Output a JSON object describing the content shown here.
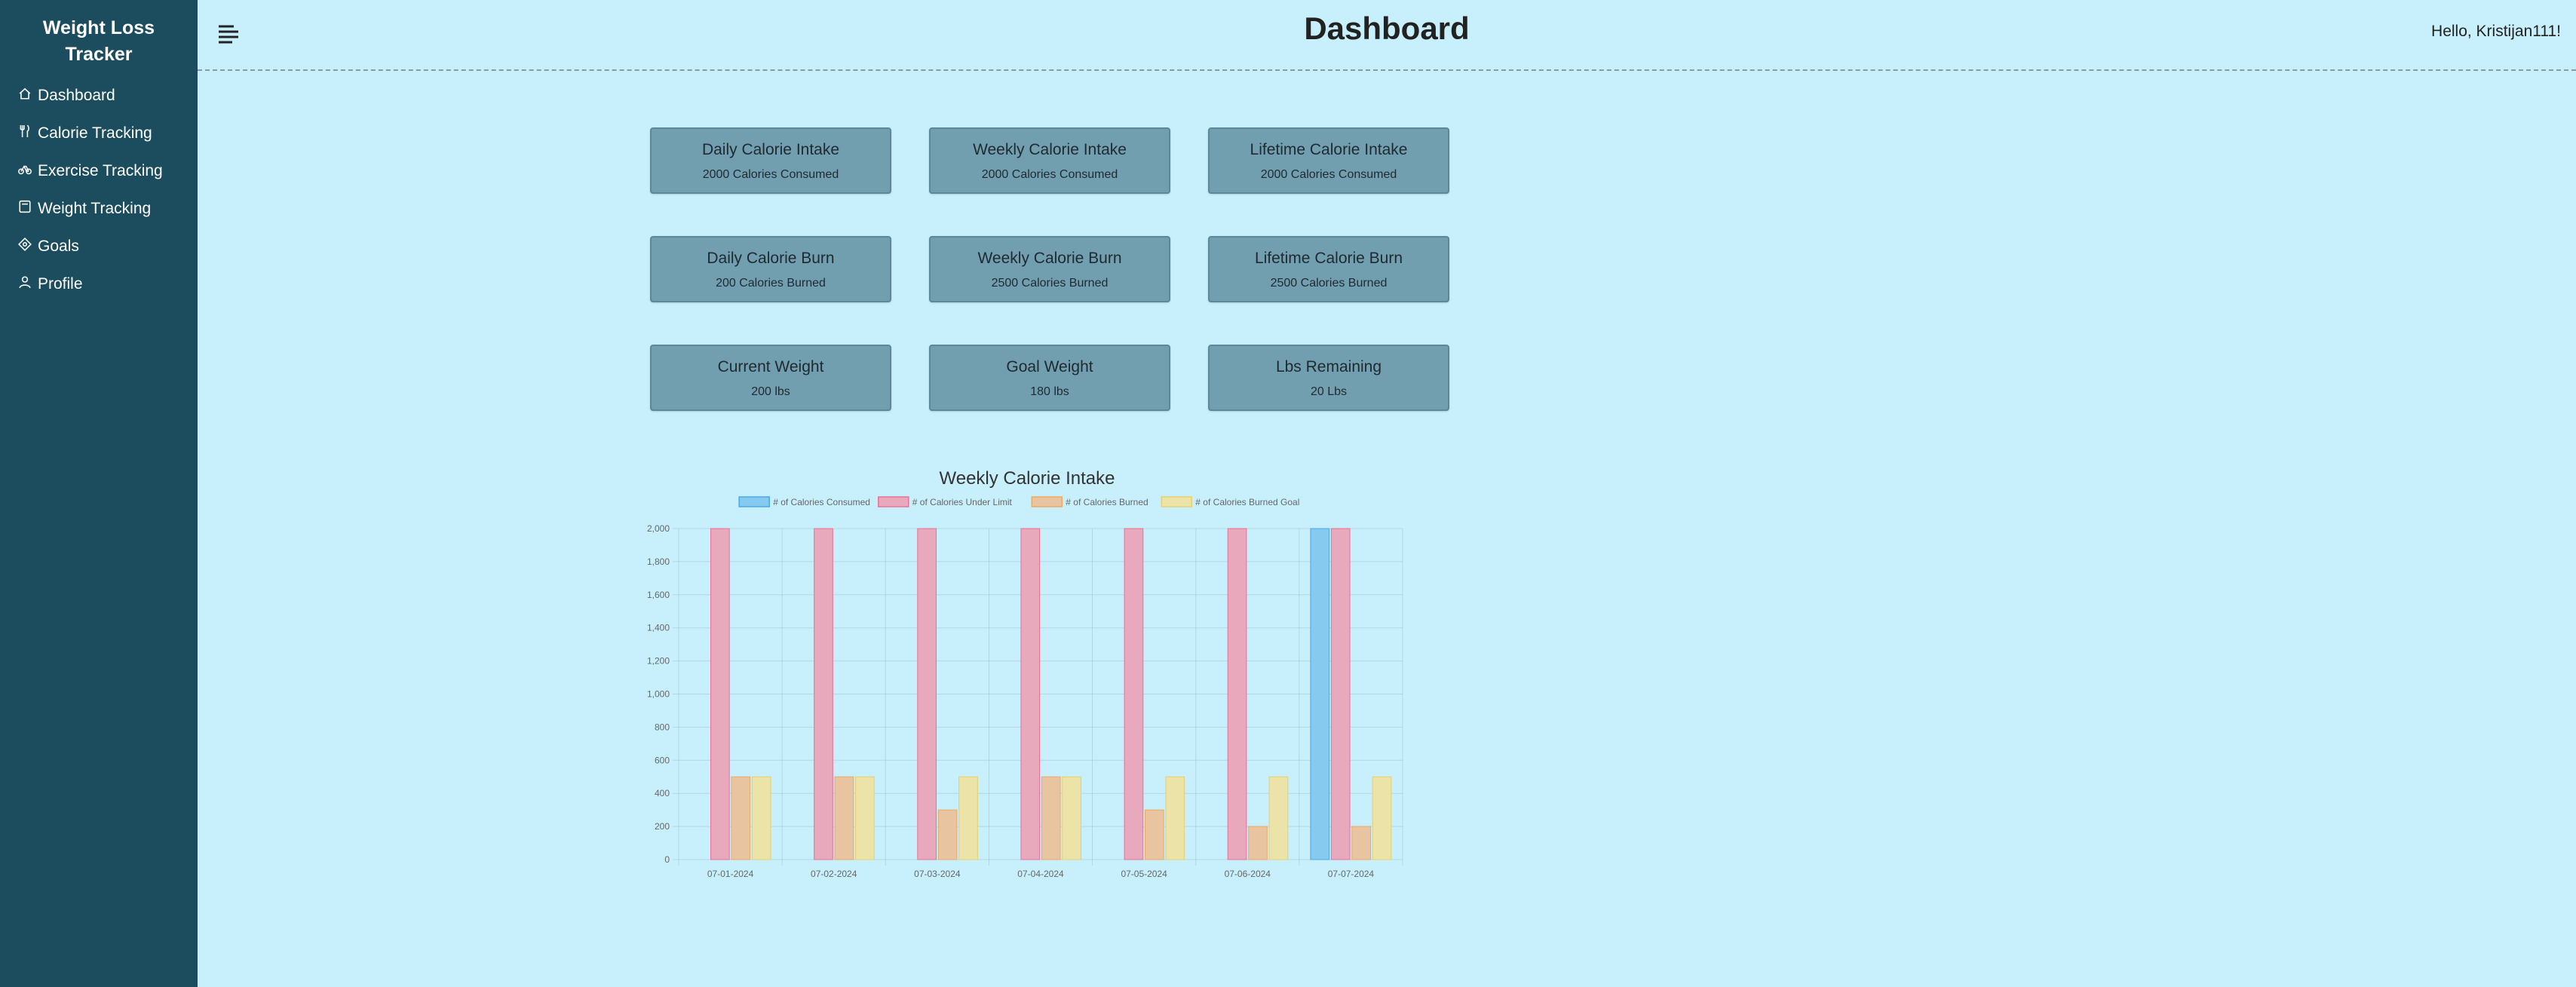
{
  "sidebar": {
    "brand": "Weight Loss Tracker",
    "items": [
      {
        "label": "Dashboard",
        "icon": "home-icon"
      },
      {
        "label": "Calorie Tracking",
        "icon": "fork-knife-icon"
      },
      {
        "label": "Exercise Tracking",
        "icon": "bicycle-icon"
      },
      {
        "label": "Weight Tracking",
        "icon": "scale-icon"
      },
      {
        "label": "Goals",
        "icon": "target-icon"
      },
      {
        "label": "Profile",
        "icon": "person-icon"
      }
    ]
  },
  "header": {
    "title": "Dashboard",
    "greeting": "Hello, Kristijan111!"
  },
  "cards": [
    {
      "title": "Daily Calorie Intake",
      "value": "2000 Calories Consumed"
    },
    {
      "title": "Weekly Calorie Intake",
      "value": "2000 Calories Consumed"
    },
    {
      "title": "Lifetime Calorie Intake",
      "value": "2000 Calories Consumed"
    },
    {
      "title": "Daily Calorie Burn",
      "value": "200 Calories Burned"
    },
    {
      "title": "Weekly Calorie Burn",
      "value": "2500 Calories Burned"
    },
    {
      "title": "Lifetime Calorie Burn",
      "value": "2500 Calories Burned"
    },
    {
      "title": "Current Weight",
      "value": "200 lbs"
    },
    {
      "title": "Goal Weight",
      "value": "180 lbs"
    },
    {
      "title": "Lbs Remaining",
      "value": "20 Lbs"
    }
  ],
  "colors": {
    "sidebar_bg": "#1b4d5e",
    "page_bg": "#c8f0fc",
    "card_bg": "#729fb0"
  },
  "chart_data": {
    "type": "bar",
    "title": "Weekly Calorie Intake",
    "categories": [
      "07-01-2024",
      "07-02-2024",
      "07-03-2024",
      "07-04-2024",
      "07-05-2024",
      "07-06-2024",
      "07-07-2024"
    ],
    "series": [
      {
        "name": "# of Calories Consumed",
        "values": [
          0,
          0,
          0,
          0,
          0,
          0,
          2000
        ],
        "fill": "#86caf0",
        "stroke": "#4aa8e8"
      },
      {
        "name": "# of Calories Under Limit",
        "values": [
          2000,
          2000,
          2000,
          2000,
          2000,
          2000,
          2000
        ],
        "fill": "#e8a9bd",
        "stroke": "#ec6f95"
      },
      {
        "name": "# of Calories Burned",
        "values": [
          500,
          500,
          300,
          500,
          300,
          200,
          200
        ],
        "fill": "#e8c5a0",
        "stroke": "#f0a860"
      },
      {
        "name": "# of Calories Burned Goal",
        "values": [
          500,
          500,
          500,
          500,
          500,
          500,
          500
        ],
        "fill": "#ece3a8",
        "stroke": "#e8d070"
      }
    ],
    "ylim": [
      0,
      2000
    ],
    "yticks": [
      0,
      200,
      400,
      600,
      800,
      1000,
      1200,
      1400,
      1600,
      1800,
      2000
    ],
    "ytick_labels": [
      "0",
      "200",
      "400",
      "600",
      "800",
      "1,000",
      "1,200",
      "1,400",
      "1,600",
      "1,800",
      "2,000"
    ],
    "legend": "top",
    "grid": true
  }
}
